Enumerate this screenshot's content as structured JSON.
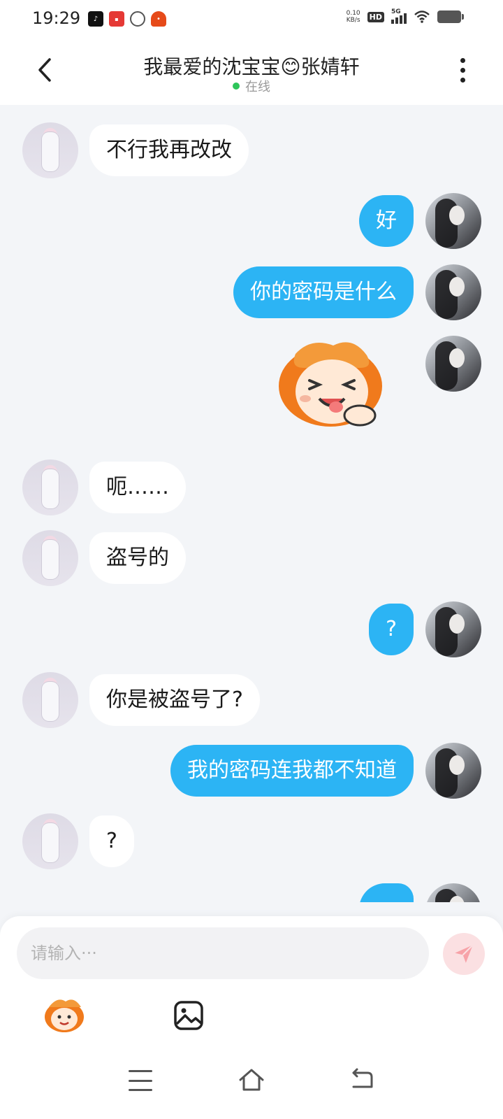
{
  "status_bar": {
    "time": "19:29",
    "net_speed_value": "0.10",
    "net_speed_unit": "KB/s",
    "hd_label": "HD",
    "network_label": "5G",
    "app_icons": [
      "tiktok-icon",
      "news-icon",
      "link-icon",
      "robot-icon"
    ]
  },
  "header": {
    "title": "我最爱的沈宝宝😊张婧轩",
    "status": "在线",
    "status_color": "#2ec55a"
  },
  "messages": [
    {
      "side": "left",
      "type": "text",
      "text": "不行我再改改"
    },
    {
      "side": "right",
      "type": "text",
      "text": "好"
    },
    {
      "side": "right",
      "type": "text",
      "text": "你的密码是什么"
    },
    {
      "side": "right",
      "type": "sticker",
      "sticker": "laughing-orange-hair-sticker"
    },
    {
      "side": "left",
      "type": "text",
      "text": "呃……"
    },
    {
      "side": "left",
      "type": "text",
      "text": "盗号的"
    },
    {
      "side": "right",
      "type": "text",
      "text": "?"
    },
    {
      "side": "left",
      "type": "text",
      "text": "你是被盗号了?"
    },
    {
      "side": "right",
      "type": "text",
      "text": "我的密码连我都不知道"
    },
    {
      "side": "left",
      "type": "text",
      "text": "?"
    }
  ],
  "input": {
    "placeholder": "请输入···"
  },
  "colors": {
    "accent_bubble": "#2cb4f4",
    "background": "#f3f5f8",
    "send_button_bg": "#fbe0e2",
    "send_icon": "#f7a2a8"
  }
}
